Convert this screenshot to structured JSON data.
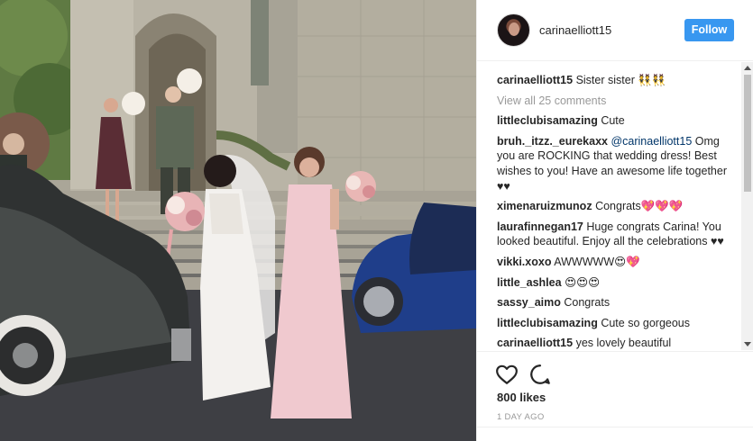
{
  "post": {
    "username": "carinaelliott15",
    "follow_label": "Follow",
    "caption": {
      "user": "carinaelliott15",
      "text": "Sister sister 👯👯"
    },
    "view_all": "View all 25 comments",
    "comments": [
      {
        "user": "littleclubisamazing",
        "text": "Cute"
      },
      {
        "user": "bruh._itzz._eurekaxx",
        "mention": "@carinaelliott15",
        "text": "Omg you are ROCKING that wedding dress! Best wishes to you! Have an awesome life together ♥♥"
      },
      {
        "user": "ximenaruizmunoz",
        "text": "Congrats💖💖💖"
      },
      {
        "user": "laurafinnegan17",
        "text": "Huge congrats Carina! You looked beautiful. Enjoy all the celebrations ♥♥"
      },
      {
        "user": "vikki.xoxo",
        "text": "AWWWWW😍💖"
      },
      {
        "user": "little_ashlea",
        "text": "😍😍😍"
      },
      {
        "user": "sassy_aimo",
        "text": "Congrats"
      },
      {
        "user": "littleclubisamazing",
        "text": "Cute so gorgeous"
      },
      {
        "user": "carinaelliott15",
        "text": "yes lovely beautiful"
      }
    ],
    "likes": "800 likes",
    "time_ago": "1 DAY AGO"
  },
  "icons": {
    "like": "heart-outline-icon",
    "comment": "comment-bubble-icon",
    "scroll_up": "scroll-up-arrow-icon",
    "scroll_down": "scroll-down-arrow-icon"
  },
  "colors": {
    "follow_button": "#3897f0",
    "username": "#262626",
    "mention": "#003569",
    "muted": "#999999",
    "divider": "#efefef"
  }
}
